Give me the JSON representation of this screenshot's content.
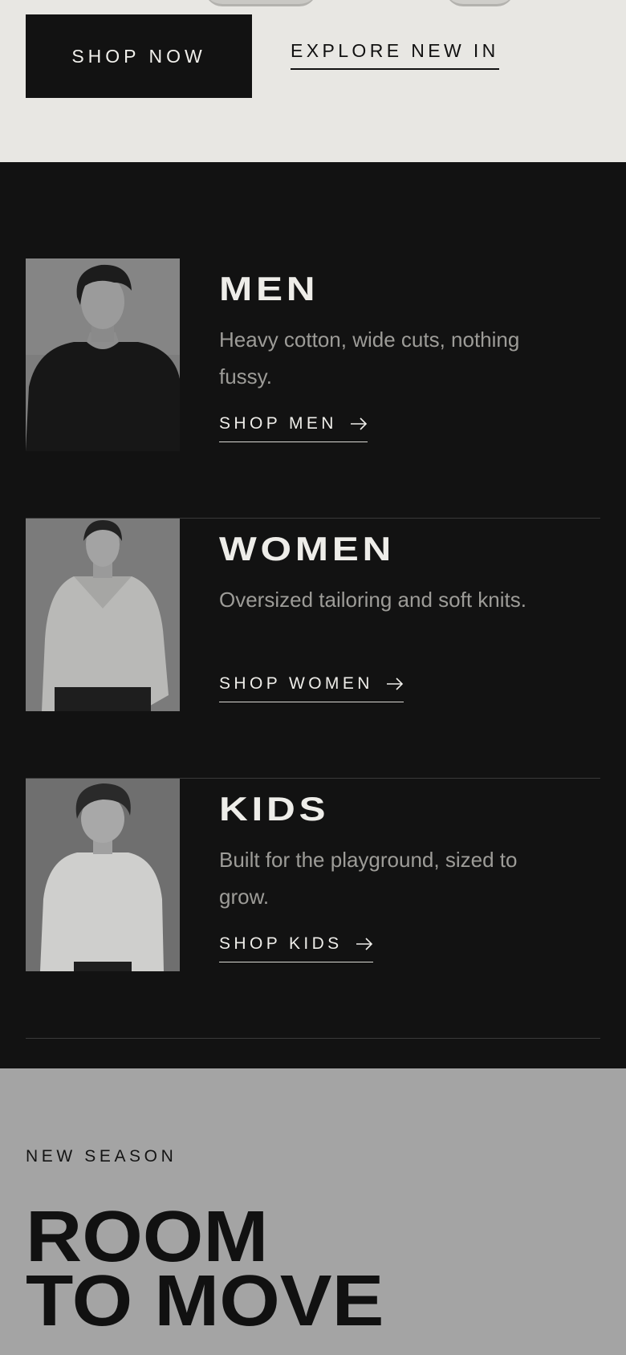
{
  "hero": {
    "shop_now_label": "SHOP NOW",
    "explore_label": "EXPLORE NEW IN"
  },
  "categories": [
    {
      "title": "MEN",
      "description": "Heavy cotton, wide cuts, nothing fussy.",
      "link_label": "SHOP MEN",
      "link_icon": "arrow-right-icon"
    },
    {
      "title": "WOMEN",
      "description": "Oversized tailoring and soft knits.",
      "link_label": "SHOP WOMEN",
      "link_icon": "arrow-right-icon"
    },
    {
      "title": "KIDS",
      "description": "Built for the playground, sized to grow.",
      "link_label": "SHOP KIDS",
      "link_icon": "arrow-right-icon"
    }
  ],
  "new_season": {
    "eyebrow": "NEW SEASON",
    "headline_line1": "ROOM",
    "headline_line2": "TO MOVE"
  },
  "colors": {
    "hero_bg": "#e8e7e3",
    "dark_bg": "#121212",
    "season_bg": "#a4a4a4",
    "text_light": "#eeede9",
    "text_muted": "#9d9c98"
  }
}
